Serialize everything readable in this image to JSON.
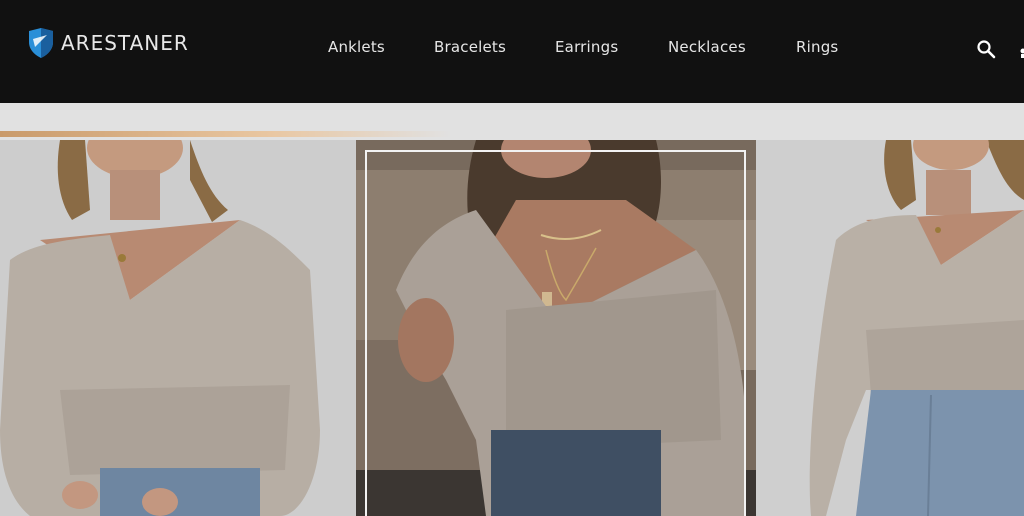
{
  "header": {
    "brand": "ARESTANER",
    "brand_colors": {
      "shield": "#2a8fd8",
      "shield_dark": "#1a5f9e"
    },
    "nav": [
      {
        "label": "Anklets"
      },
      {
        "label": "Bracelets"
      },
      {
        "label": "Earrings"
      },
      {
        "label": "Necklaces"
      },
      {
        "label": "Rings"
      }
    ],
    "icons": {
      "search": "search-icon",
      "account": "partial-icon"
    }
  },
  "carousel": {
    "progress": 0.44,
    "accent": "#d4a878",
    "slides": [
      {
        "name": "product-image-left",
        "description_icon": "model-wrap-sweater-photo"
      },
      {
        "name": "product-image-center",
        "description_icon": "model-wrap-sweater-photo",
        "active": true
      },
      {
        "name": "product-image-right",
        "description_icon": "model-wrap-sweater-photo"
      }
    ]
  }
}
